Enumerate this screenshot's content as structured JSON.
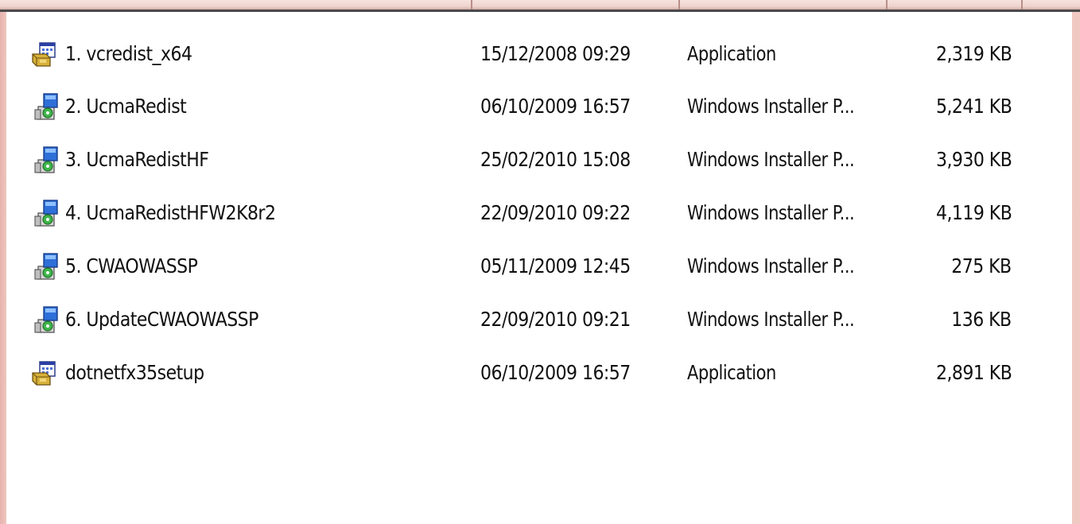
{
  "files": [
    {
      "name": "1. vcredist_x64",
      "modified": "15/12/2008 09:29",
      "type": "Application",
      "size": "2,319 KB",
      "icon": "application-icon"
    },
    {
      "name": "2. UcmaRedist",
      "modified": "06/10/2009 16:57",
      "type": "Windows Installer P...",
      "size": "5,241 KB",
      "icon": "installer-package-icon"
    },
    {
      "name": "3. UcmaRedistHF",
      "modified": "25/02/2010 15:08",
      "type": "Windows Installer P...",
      "size": "3,930 KB",
      "icon": "installer-package-icon"
    },
    {
      "name": "4. UcmaRedistHFW2K8r2",
      "modified": "22/09/2010 09:22",
      "type": "Windows Installer P...",
      "size": "4,119 KB",
      "icon": "installer-package-icon"
    },
    {
      "name": "5. CWAOWASSP",
      "modified": "05/11/2009 12:45",
      "type": "Windows Installer P...",
      "size": "275 KB",
      "icon": "installer-package-icon"
    },
    {
      "name": "6. UpdateCWAOWASSP",
      "modified": "22/09/2010 09:21",
      "type": "Windows Installer P...",
      "size": "136 KB",
      "icon": "installer-package-icon"
    },
    {
      "name": "dotnetfx35setup",
      "modified": "06/10/2009 16:57",
      "type": "Application",
      "size": "2,891 KB",
      "icon": "application-icon"
    }
  ],
  "colors": {
    "background_tint": "#f3d2cd",
    "list_background": "#ffffff",
    "text": "#101010"
  }
}
